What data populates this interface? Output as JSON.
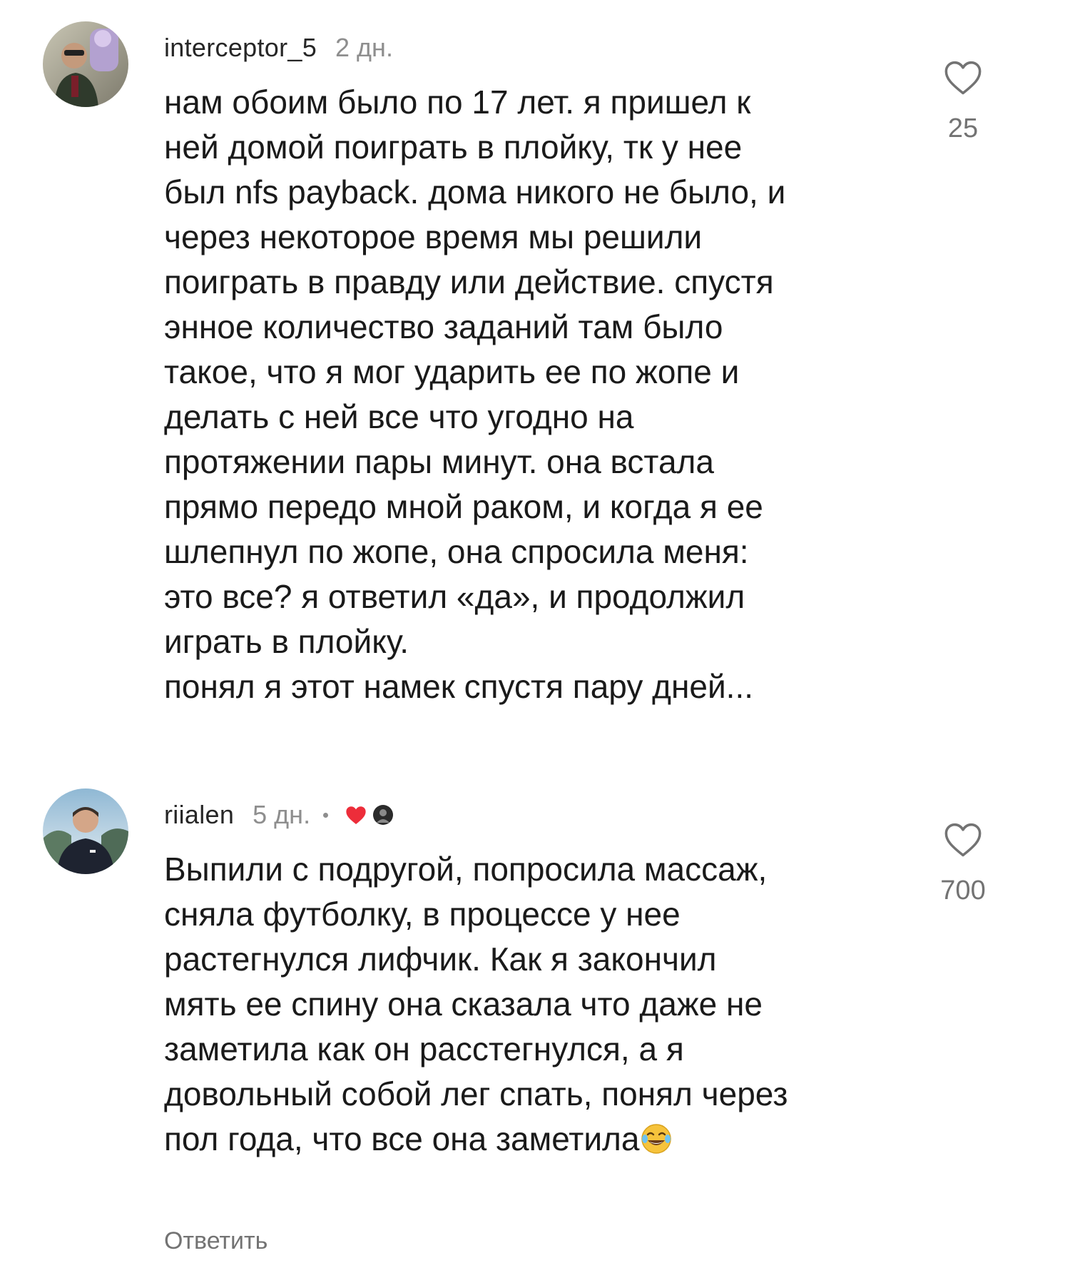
{
  "comments": [
    {
      "username": "interceptor_5",
      "timestamp": "2 дн.",
      "text": "нам обоим было по 17 лет. я пришел к\nней домой поиграть в плойку, тк у нее\nбыл nfs payback. дома никого не было, и\nчерез некоторое время мы решили\nпоиграть в правду или действие. спустя\nэнное количество заданий там было\nтакое, что я мог ударить ее по жопе и\nделать с ней все что угодно на\nпротяжении пары минут. она встала\nпрямо передо мной раком, и когда я ее\nшлепнул по жопе, она спросила меня:\nэто все? я ответил «да», и продолжил\nиграть в плойку.\nпонял я этот намек спустя пару дней...",
      "likes": "25",
      "icons": {
        "avatar": "user-avatar-icon",
        "like": "heart-outline-icon"
      }
    },
    {
      "username": "riialen",
      "timestamp": "5 дн.",
      "text": "Выпили с подругой, попросила массаж,\nсняла футболку, в процессе у нее\nрастегнулся лифчик. Как я закончил\nмять ее спину она сказала что даже не\nзаметила как он расстегнулся, а я\nдовольный собой лег спать, понял через\nпол года, что все она заметила",
      "emoji": "😂",
      "likes": "700",
      "reply_label": "Ответить",
      "icons": {
        "avatar": "user-avatar-icon",
        "like": "heart-outline-icon",
        "creator_like": "red-heart-icon",
        "liked_by_avatar": "liked-by-avatar-icon"
      }
    }
  ],
  "colors": {
    "text": "#1a1a1a",
    "muted": "#8e8e8e",
    "heart_red": "#ed2d3a"
  }
}
